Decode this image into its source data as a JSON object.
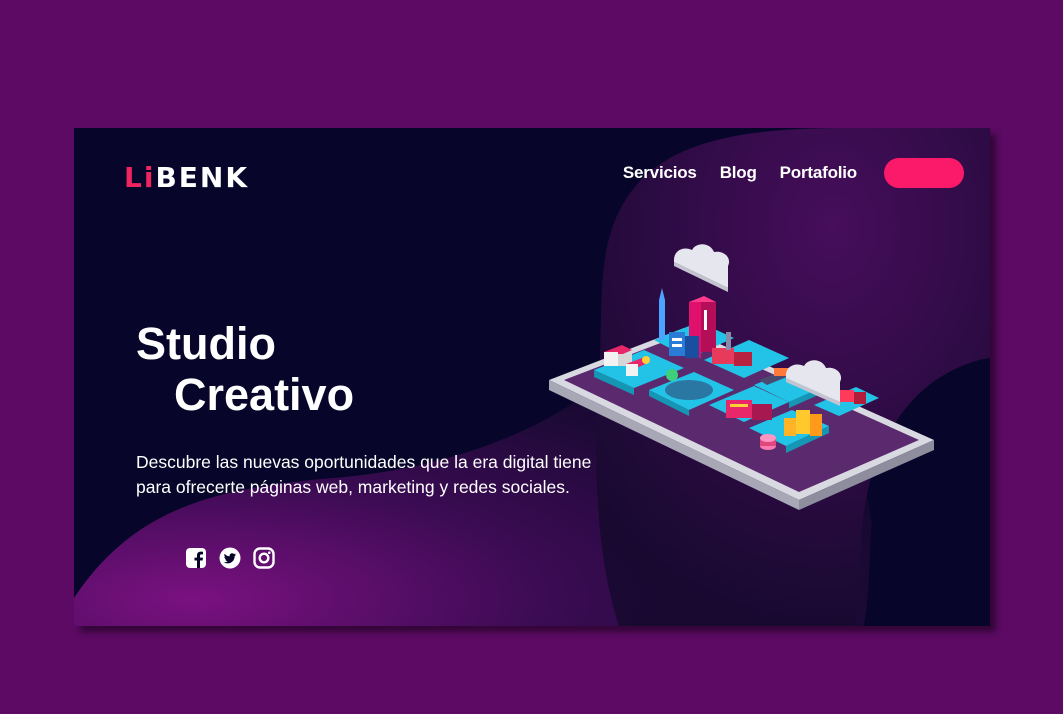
{
  "brand": {
    "logo_accent": "Li",
    "logo_rest": "BENK",
    "accent_color": "#f0245e"
  },
  "nav": {
    "items": [
      "Servicios",
      "Blog",
      "Portafolio"
    ],
    "cta_label": "",
    "cta_color": "#fb1a6a"
  },
  "hero": {
    "title_line1": "Studio",
    "title_line2": "Creativo",
    "description": "Descubre las nuevas oportunidades que la era digital tiene para ofrecerte páginas web, marketing  y redes sociales."
  },
  "social": {
    "icons": [
      "facebook-icon",
      "twitter-icon",
      "instagram-icon"
    ]
  },
  "colors": {
    "page_background": "#5c0a64",
    "card_background": "#07062a",
    "blob_purple": "#3a0b52"
  }
}
